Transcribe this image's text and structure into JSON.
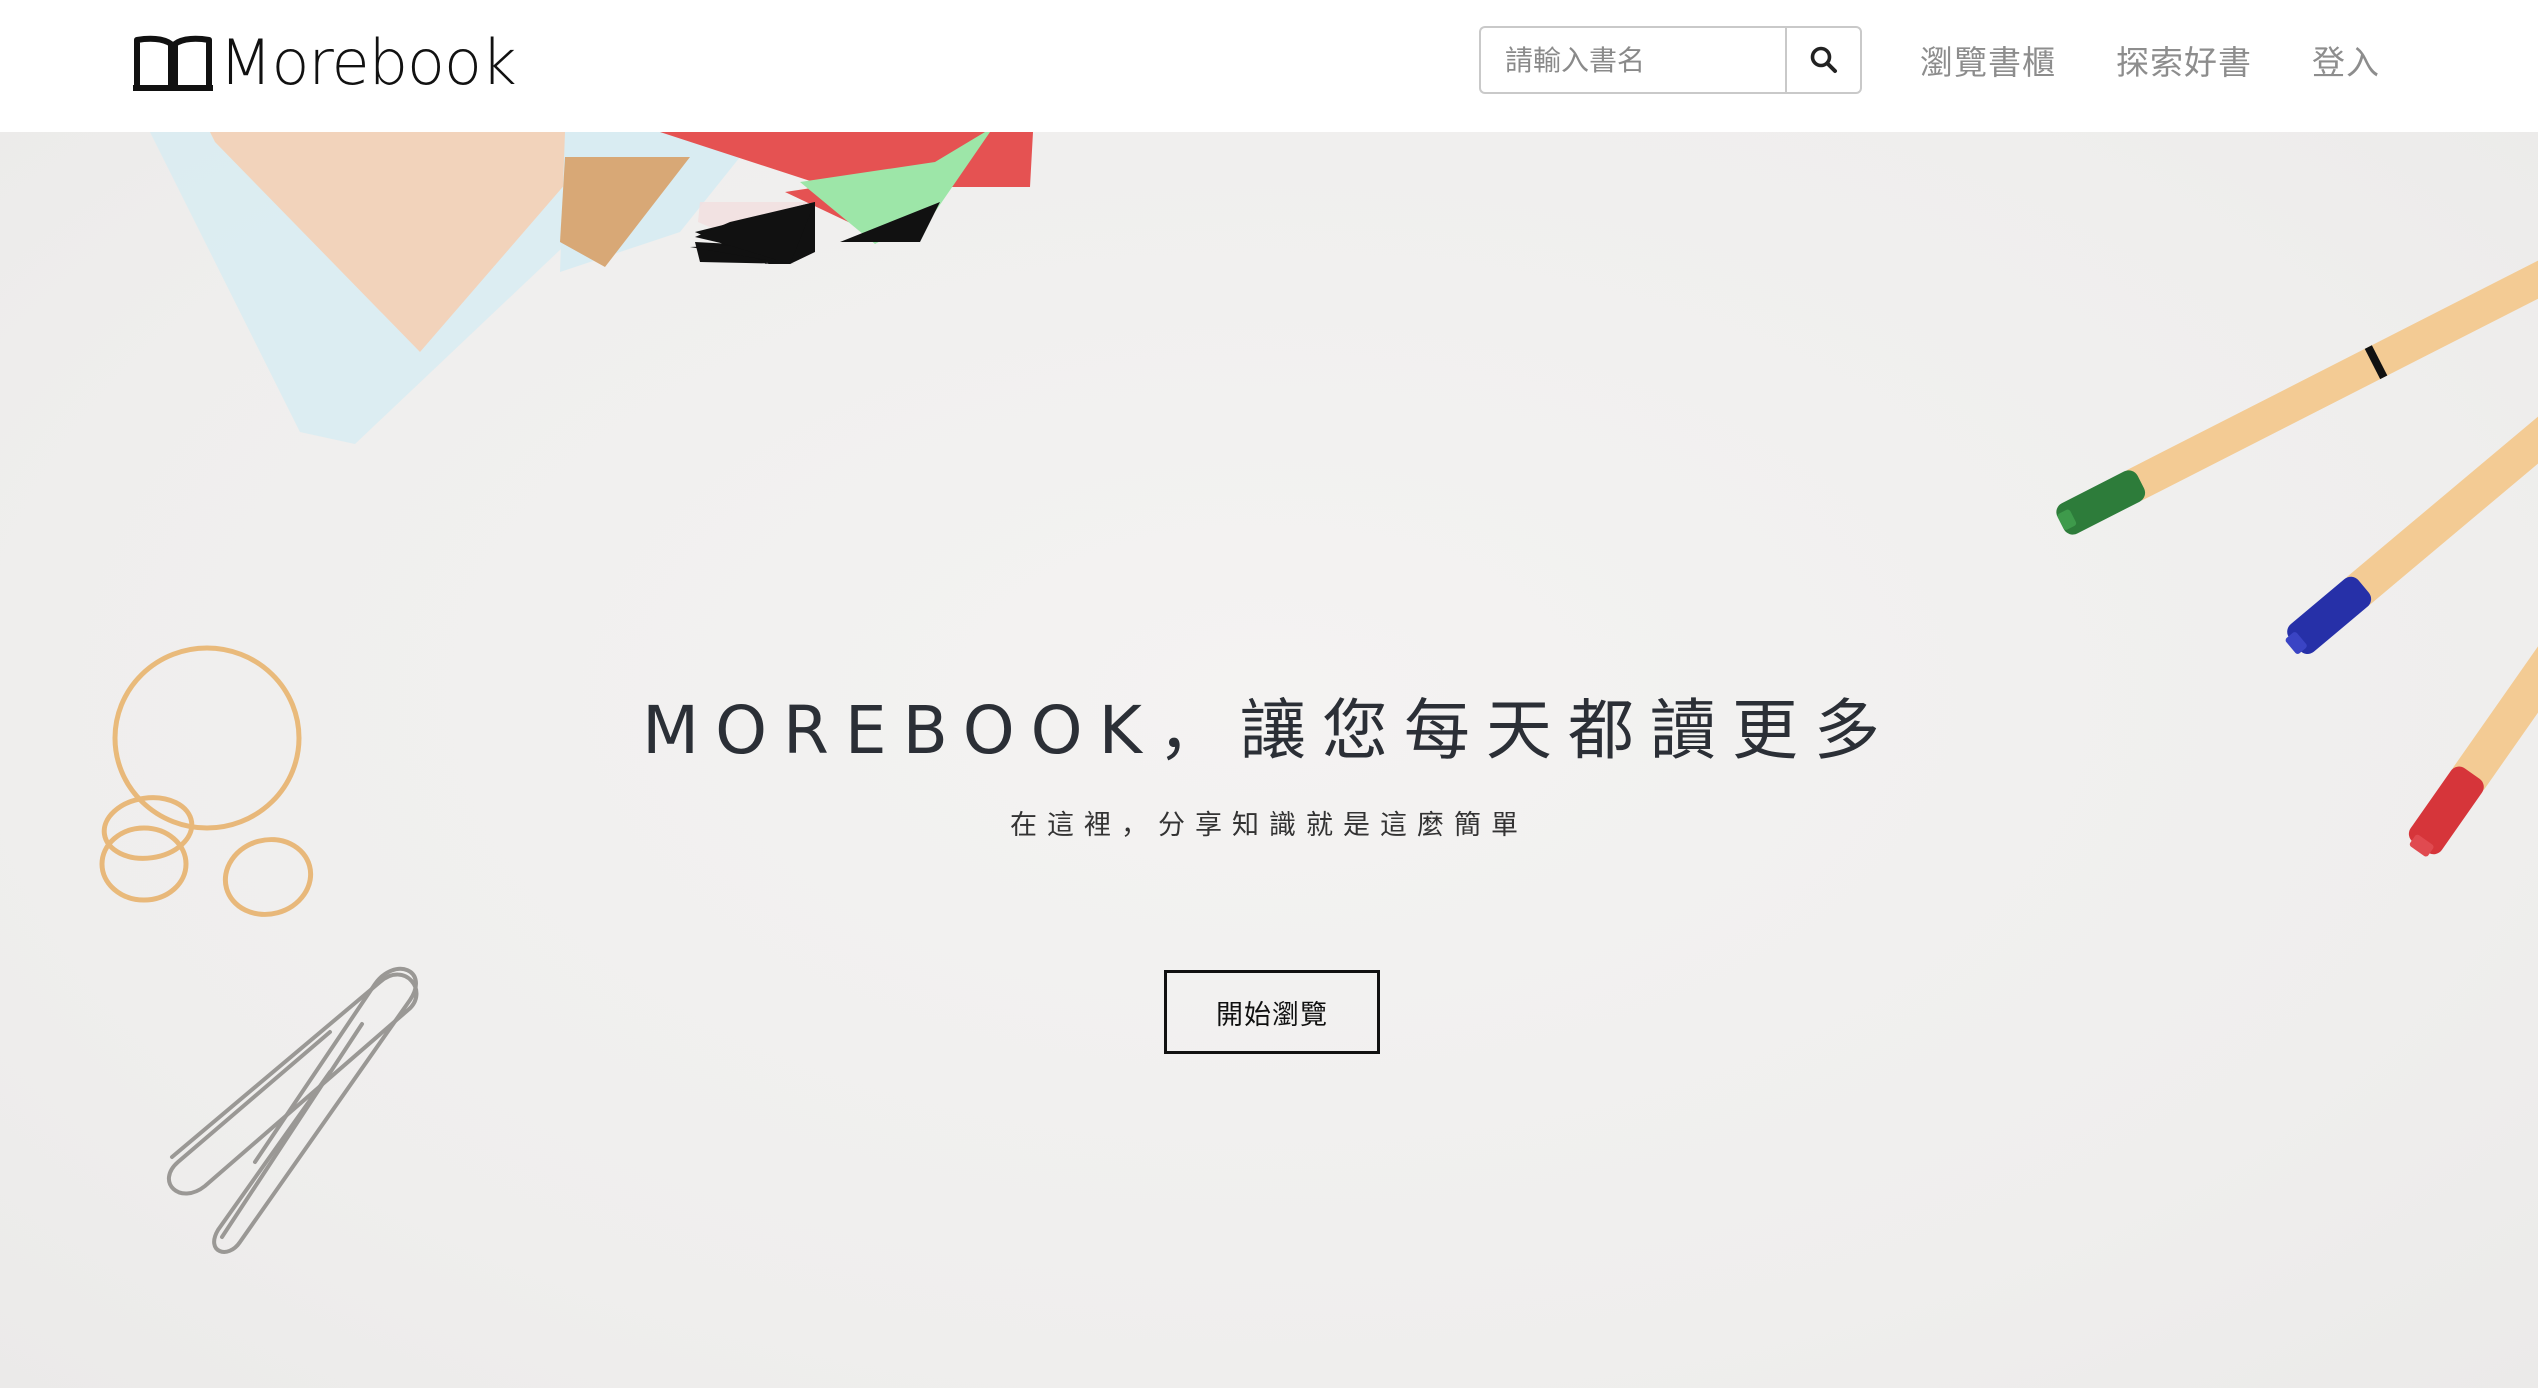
{
  "brand": {
    "name": "Morebook"
  },
  "search": {
    "placeholder": "請輸入書名",
    "value": ""
  },
  "nav": {
    "items": [
      {
        "label": "瀏覽書櫃"
      },
      {
        "label": "探索好書"
      },
      {
        "label": "登入"
      }
    ]
  },
  "hero": {
    "title": "MOREBOOK，讓您每天都讀更多",
    "subtitle": "在這裡，分享知識就是這麼簡單",
    "cta_label": "開始瀏覽"
  },
  "colors": {
    "navbar_bg": "#ffffff",
    "hero_bg": "#f1f0ef",
    "title_text": "#2b2f36",
    "nav_link": "#8d8d8d"
  }
}
